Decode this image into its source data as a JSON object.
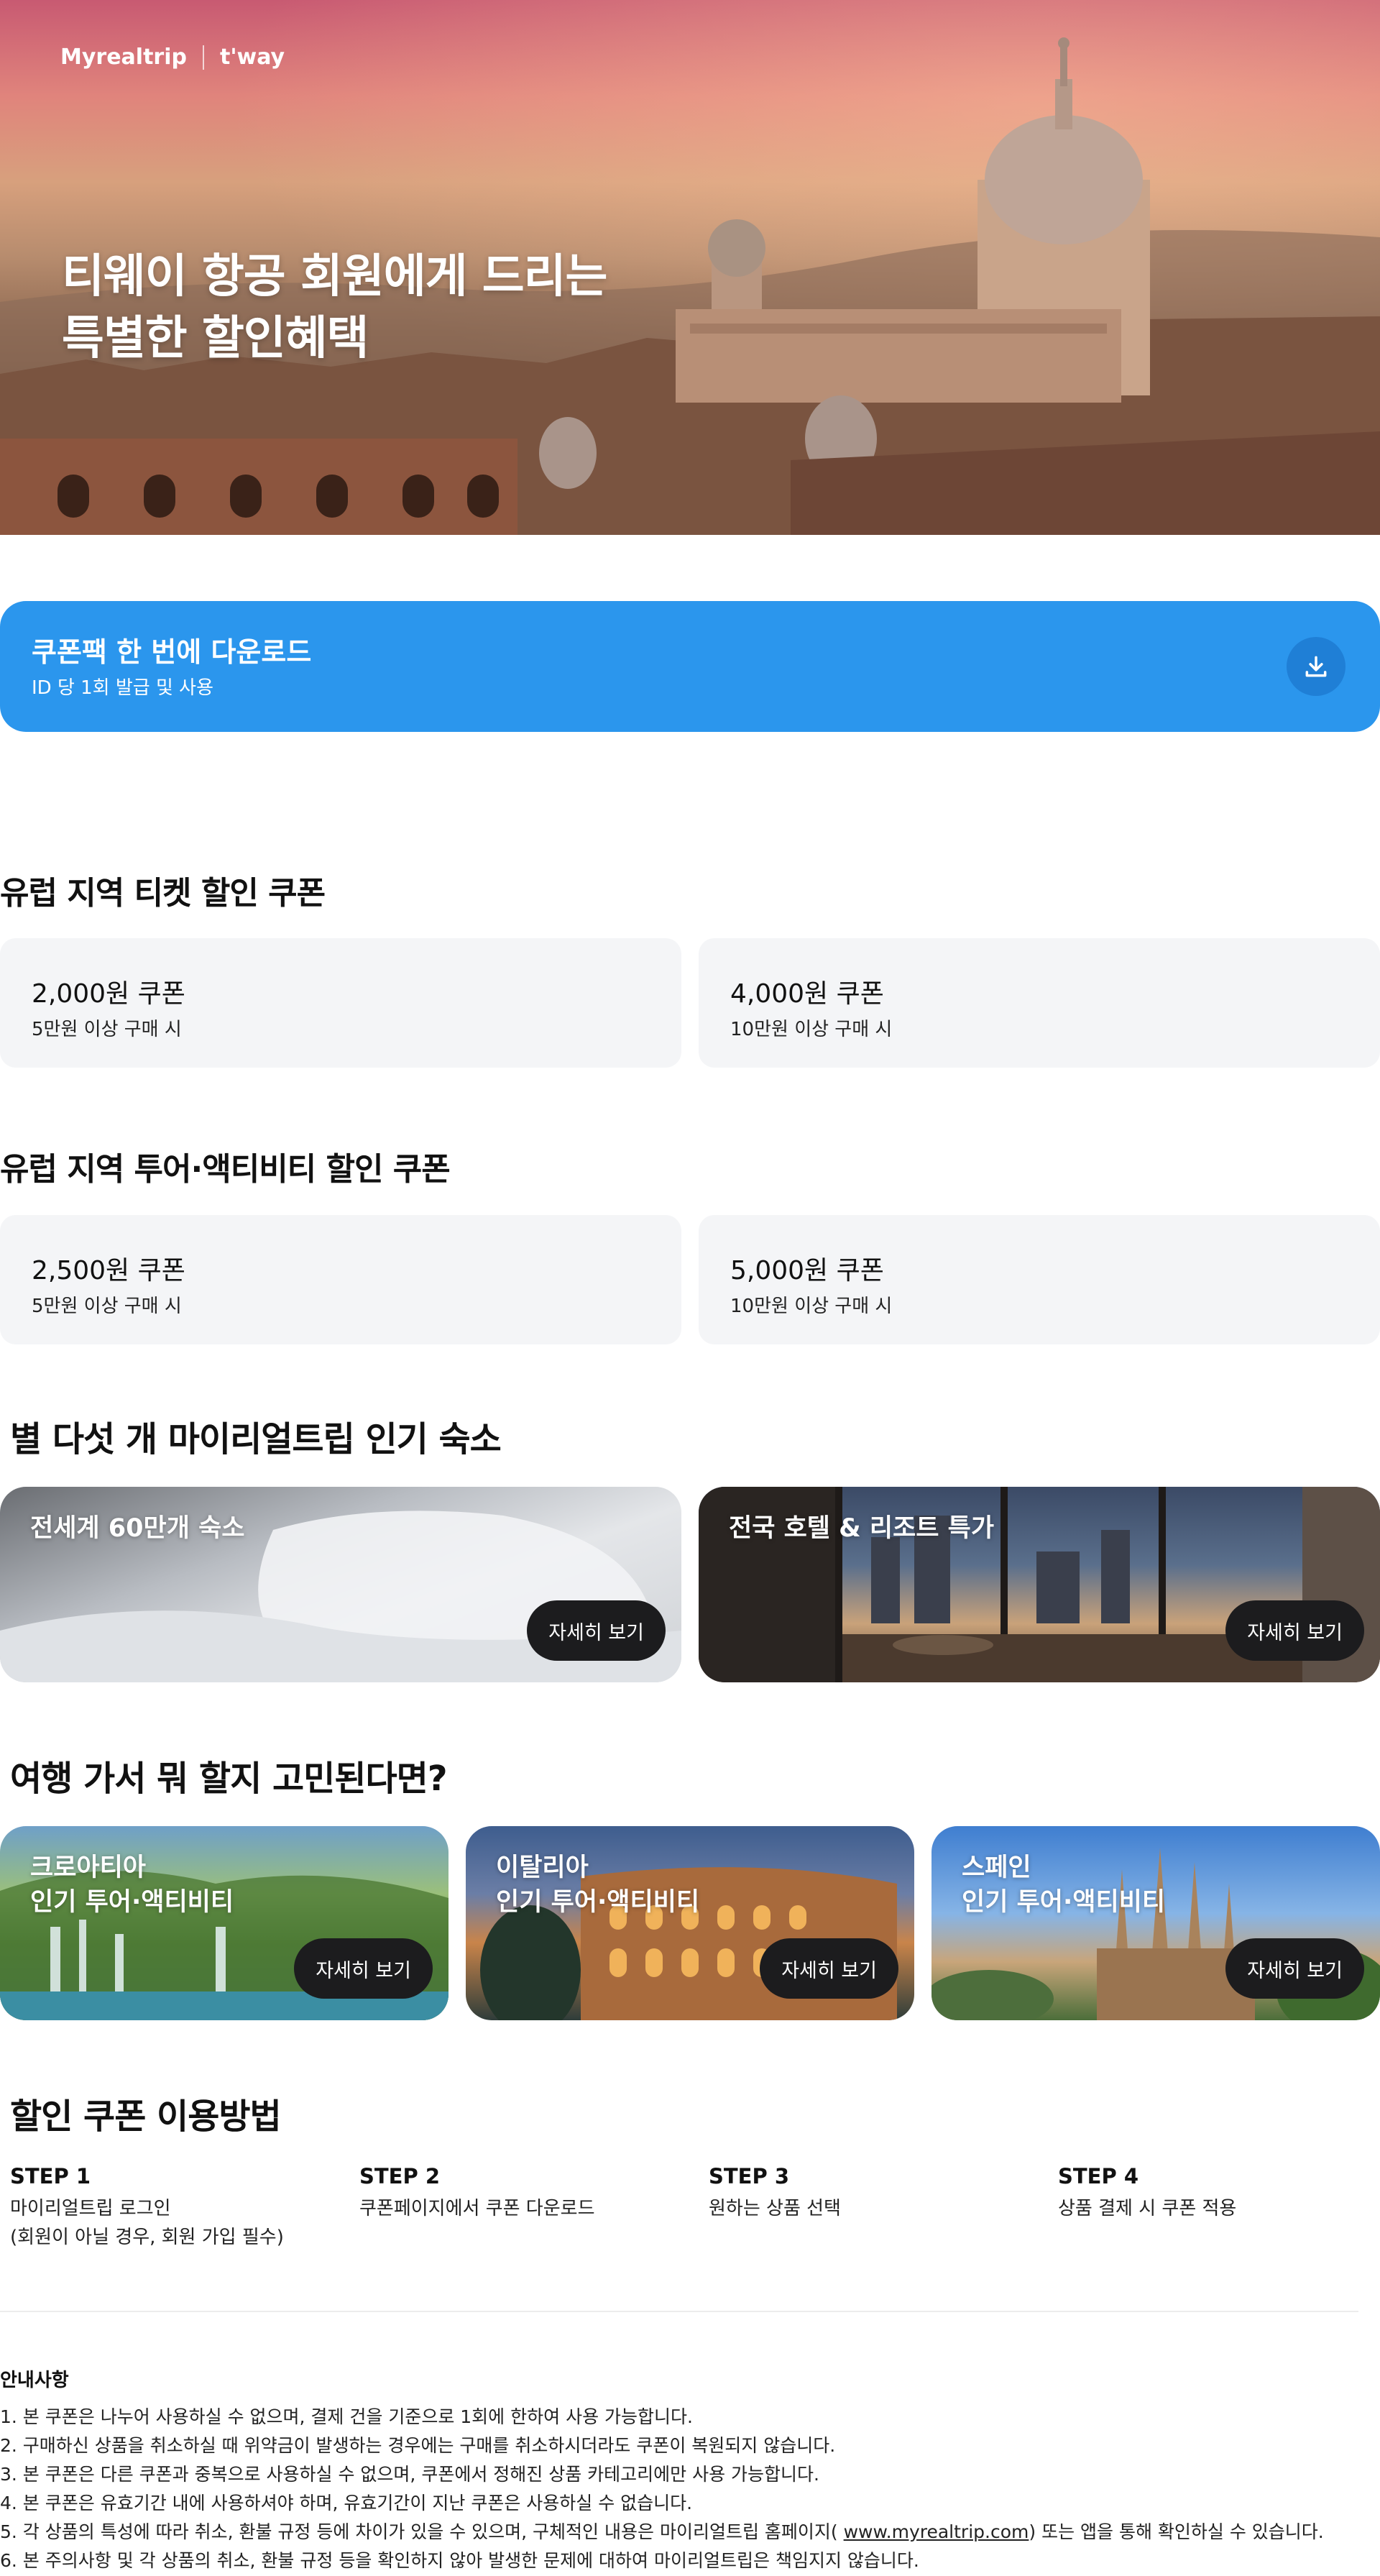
{
  "header": {
    "brand": "Myrealtrip",
    "partner": "t'way"
  },
  "hero": {
    "title_line1": "티웨이 항공 회원에게 드리는",
    "title_line2": "특별한 할인혜택"
  },
  "download_banner": {
    "title": "쿠폰팩 한 번에 다운로드",
    "subtitle": "ID 당 1회 발급 및 사용",
    "icon": "download-icon"
  },
  "ticket_section": {
    "title": "유럽 지역 티켓 할인 쿠폰",
    "coupons": [
      {
        "amount": "2,000원 쿠폰",
        "condition": "5만원 이상 구매 시"
      },
      {
        "amount": "4,000원 쿠폰",
        "condition": "10만원 이상 구매 시"
      }
    ]
  },
  "tour_section": {
    "title": "유럽 지역 투어·액티비티 할인 쿠폰",
    "coupons": [
      {
        "amount": "2,500원 쿠폰",
        "condition": "5만원 이상 구매 시"
      },
      {
        "amount": "5,000원 쿠폰",
        "condition": "10만원 이상 구매 시"
      }
    ]
  },
  "stay_section": {
    "title": "별 다섯 개 마이리얼트립 인기 숙소",
    "cards": [
      {
        "label": "전세계 60만개 숙소",
        "button": "자세히 보기"
      },
      {
        "label": "전국 호텔 & 리조트 특가",
        "button": "자세히 보기"
      }
    ]
  },
  "activity_section": {
    "title": "여행 가서 뭐 할지 고민된다면?",
    "cards": [
      {
        "country": "크로아티아",
        "label": "인기 투어·액티비티",
        "button": "자세히 보기"
      },
      {
        "country": "이탈리아",
        "label": "인기 투어·액티비티",
        "button": "자세히 보기"
      },
      {
        "country": "스페인",
        "label": "인기 투어·액티비티",
        "button": "자세히 보기"
      }
    ]
  },
  "howto": {
    "title": "할인 쿠폰 이용방법",
    "steps": [
      {
        "step": "STEP 1",
        "line1": "마이리얼트립 로그인",
        "line2": "(회원이 아닐 경우, 회원 가입 필수)"
      },
      {
        "step": "STEP 2",
        "line1": "쿠폰페이지에서 쿠폰 다운로드",
        "line2": ""
      },
      {
        "step": "STEP 3",
        "line1": "원하는 상품 선택",
        "line2": ""
      },
      {
        "step": "STEP 4",
        "line1": "상품 결제 시 쿠폰 적용",
        "line2": ""
      }
    ]
  },
  "notice": {
    "title": "안내사항",
    "items": [
      "1.  본 쿠폰은 나누어 사용하실 수 없으며, 결제 건을 기준으로 1회에 한하여 사용 가능합니다.",
      "2. 구매하신 상품을 취소하실 때 위약금이 발생하는 경우에는 구매를 취소하시더라도 쿠폰이 복원되지 않습니다.",
      "3. 본 쿠폰은 다른 쿠폰과 중복으로 사용하실 수 없으며, 쿠폰에서 정해진 상품 카테고리에만 사용 가능합니다.",
      "4. 본 쿠폰은 유효기간 내에 사용하셔야 하며, 유효기간이 지난 쿠폰은 사용하실 수 없습니다."
    ],
    "item5_before": "5. 각 상품의 특성에 따라 취소, 환불 규정 등에 차이가 있을 수 있으며, 구체적인 내용은 마이리얼트립 홈페이지( ",
    "item5_link": "www.myrealtrip.com",
    "item5_after": ") 또는 앱을 통해 확인하실 수 있습니다.",
    "item6": "6. 본 주의사항 및 각 상품의 취소, 환불 규정 등을 확인하지 않아 발생한 문제에 대하여 마이리얼트립은 책임지지 않습니다."
  },
  "colors": {
    "accent": "#2b96ed",
    "button_dark": "#1c1c1e",
    "coupon_bg": "#f4f5f7"
  }
}
